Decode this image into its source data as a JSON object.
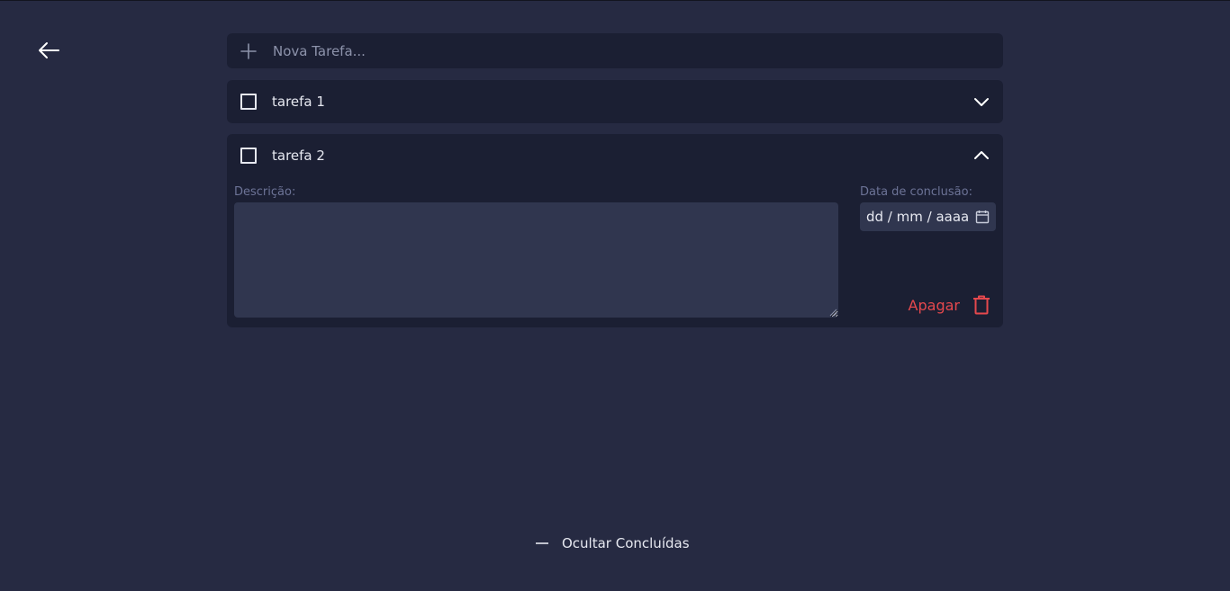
{
  "new_task": {
    "placeholder": "Nova Tarefa..."
  },
  "tasks": [
    {
      "title": "tarefa 1",
      "expanded": false,
      "done": false
    },
    {
      "title": "tarefa 2",
      "expanded": true,
      "done": false
    }
  ],
  "details": {
    "description_label": "Descrição:",
    "description_value": "",
    "date_label": "Data de conclusão:",
    "date_placeholder": "dd / mm / aaaa",
    "delete_label": "Apagar"
  },
  "footer": {
    "toggle_label": "Ocultar Concluídas"
  },
  "icons": {
    "back": "arrow-left-icon",
    "add": "plus-icon",
    "collapsed": "chevron-down-icon",
    "expanded": "chevron-up-icon",
    "calendar": "calendar-icon",
    "delete": "trash-icon",
    "toggle": "minus-icon"
  },
  "colors": {
    "background": "#262a42",
    "card": "#1b1f33",
    "field": "#30364f",
    "muted_label": "#6c7396",
    "danger": "#e5484d"
  }
}
